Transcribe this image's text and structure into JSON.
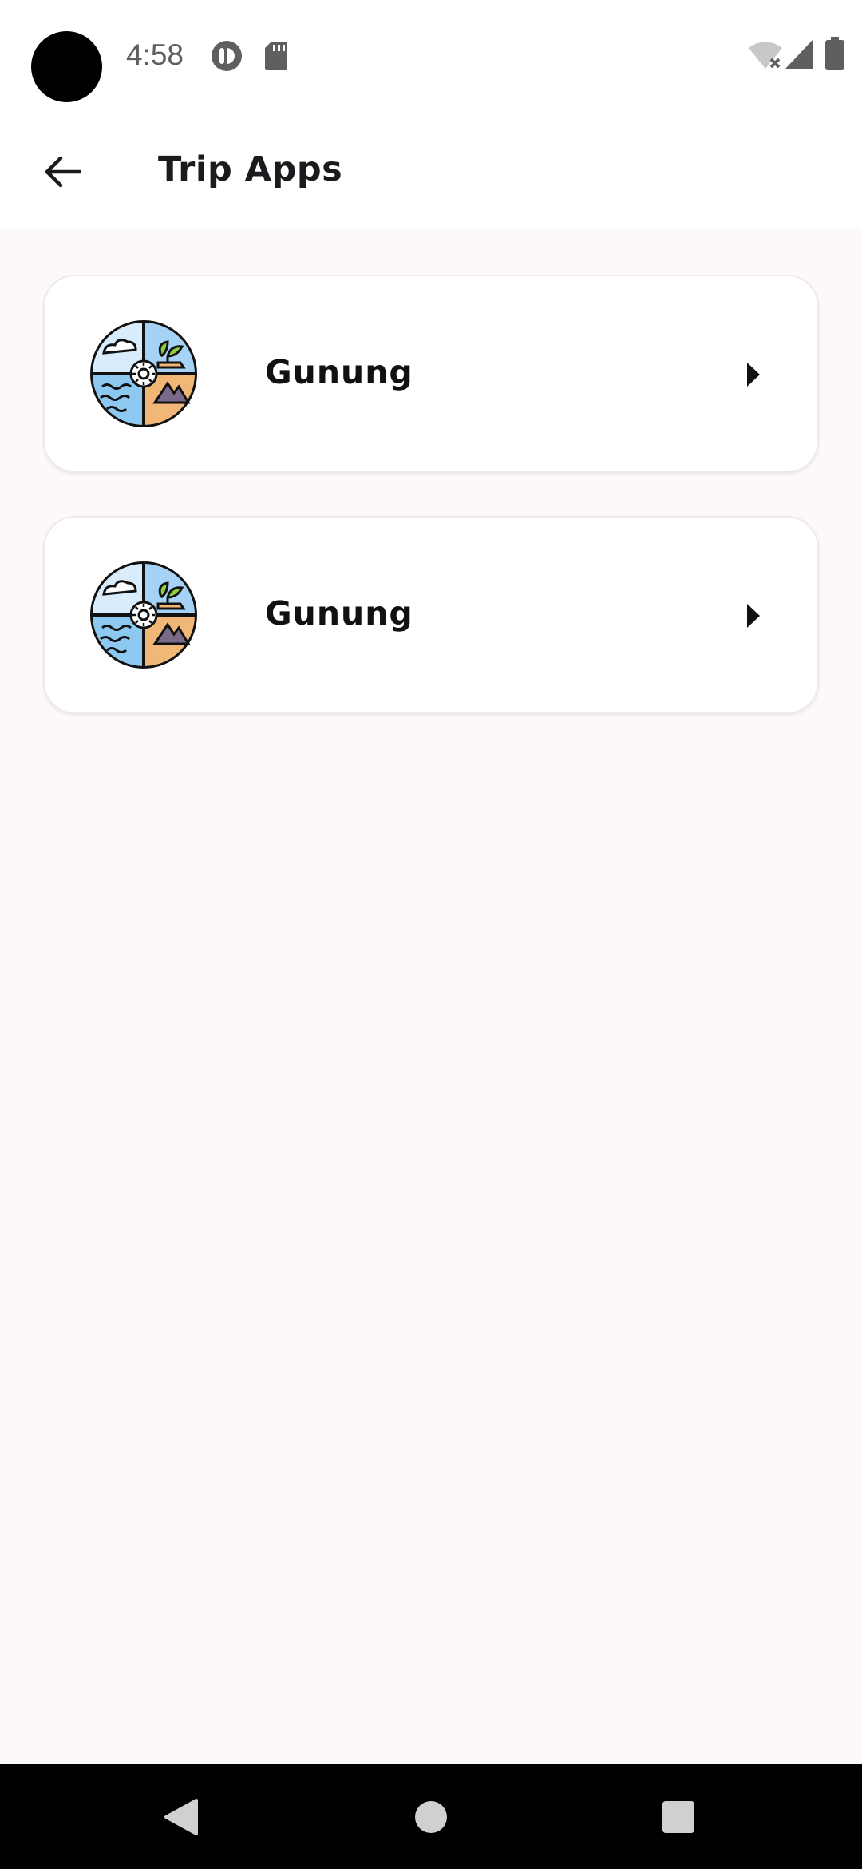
{
  "status_bar": {
    "time": "4:58",
    "icons": [
      "pocket-casts-icon",
      "sd-card-icon",
      "wifi-off-icon",
      "cell-signal-icon",
      "battery-icon"
    ]
  },
  "app_bar": {
    "title": "Trip Apps",
    "back_icon": "arrow-left-icon"
  },
  "items": [
    {
      "label": "Gunung",
      "icon": "nature-quadrant-icon",
      "chevron": "caret-right-icon"
    },
    {
      "label": "Gunung",
      "icon": "nature-quadrant-icon",
      "chevron": "caret-right-icon"
    }
  ],
  "nav_bar": {
    "buttons": [
      "back-triangle-icon",
      "home-circle-icon",
      "recents-square-icon"
    ]
  },
  "colors": {
    "background": "#fdf8fc",
    "card": "#ffffff",
    "sky": "#a6d3f5",
    "sun_light": "#d8ecfb",
    "water": "#8cc8f0",
    "earth": "#f0b777",
    "leaf": "#8fce3f"
  }
}
